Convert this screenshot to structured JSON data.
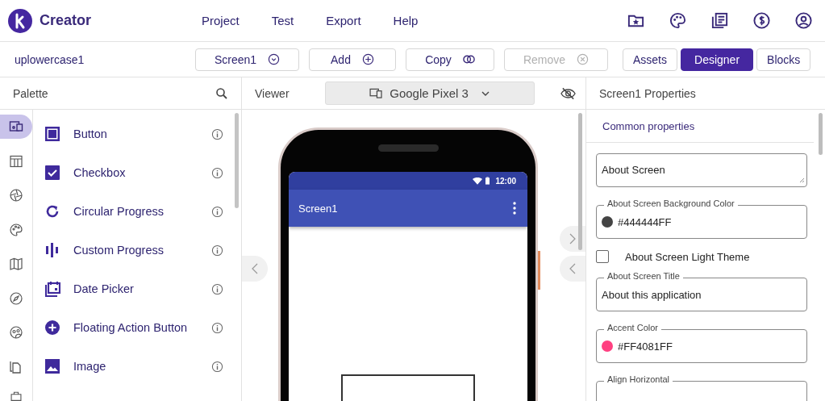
{
  "app": {
    "name": "Creator"
  },
  "menu": [
    "Project",
    "Test",
    "Export",
    "Help"
  ],
  "toolbar": {
    "project": "uplowercase1",
    "screen": "Screen1",
    "add": "Add",
    "copy": "Copy",
    "remove": {
      "label": "Remove",
      "disabled": true
    },
    "views": [
      {
        "label": "Assets",
        "selected": false
      },
      {
        "label": "Designer",
        "selected": true
      },
      {
        "label": "Blocks",
        "selected": false
      }
    ]
  },
  "palette": {
    "title": "Palette",
    "categories": [
      {
        "kind": "user-interface",
        "selected": true
      },
      {
        "kind": "layout",
        "selected": false
      },
      {
        "kind": "media",
        "selected": false
      },
      {
        "kind": "drawing",
        "selected": false
      },
      {
        "kind": "maps",
        "selected": false
      },
      {
        "kind": "sensors",
        "selected": false
      },
      {
        "kind": "social",
        "selected": false
      },
      {
        "kind": "storage",
        "selected": false
      }
    ],
    "items": [
      {
        "label": "Button",
        "kind": "button"
      },
      {
        "label": "Checkbox",
        "kind": "checkbox"
      },
      {
        "label": "Circular Progress",
        "kind": "circular"
      },
      {
        "label": "Custom Progress",
        "kind": "custom"
      },
      {
        "label": "Date Picker",
        "kind": "date"
      },
      {
        "label": "Floating Action Button",
        "kind": "fab"
      },
      {
        "label": "Image",
        "kind": "image"
      }
    ]
  },
  "viewer": {
    "title": "Viewer",
    "device": "Google Pixel 3",
    "phone": {
      "time": "12:00",
      "screen_title": "Screen1"
    }
  },
  "properties": {
    "title": "Screen1 Properties",
    "section": "Common properties",
    "fields": [
      {
        "kind": "textarea",
        "value": "About Screen"
      },
      {
        "kind": "color",
        "label": "About Screen Background Color",
        "value": "#444444FF",
        "color": "#444444"
      },
      {
        "kind": "checkbox",
        "label": "About Screen Light Theme",
        "checked": false
      },
      {
        "kind": "text",
        "label": "About Screen Title",
        "value": "About this application"
      },
      {
        "kind": "color",
        "label": "Accent Color",
        "value": "#FF4081FF",
        "color": "#ff4081"
      },
      {
        "kind": "text",
        "label": "Align Horizontal"
      }
    ]
  }
}
